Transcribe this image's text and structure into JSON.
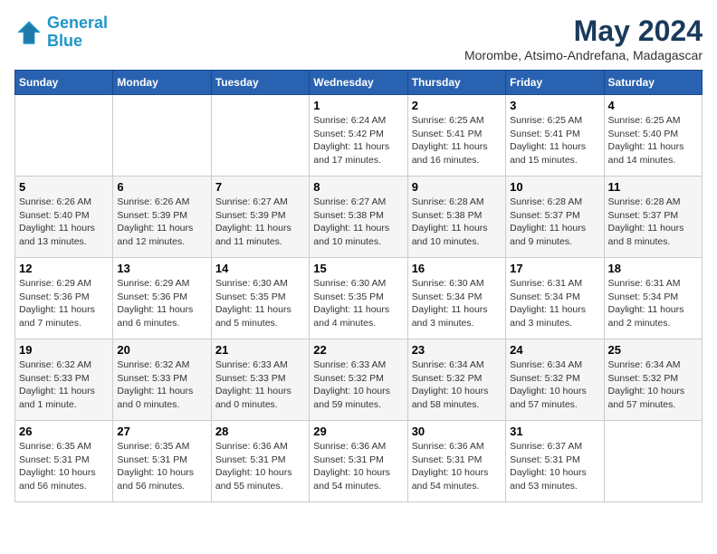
{
  "header": {
    "logo_line1": "General",
    "logo_line2": "Blue",
    "month": "May 2024",
    "location": "Morombe, Atsimo-Andrefana, Madagascar"
  },
  "days_of_week": [
    "Sunday",
    "Monday",
    "Tuesday",
    "Wednesday",
    "Thursday",
    "Friday",
    "Saturday"
  ],
  "weeks": [
    [
      {
        "day": "",
        "info": ""
      },
      {
        "day": "",
        "info": ""
      },
      {
        "day": "",
        "info": ""
      },
      {
        "day": "1",
        "info": "Sunrise: 6:24 AM\nSunset: 5:42 PM\nDaylight: 11 hours and 17 minutes."
      },
      {
        "day": "2",
        "info": "Sunrise: 6:25 AM\nSunset: 5:41 PM\nDaylight: 11 hours and 16 minutes."
      },
      {
        "day": "3",
        "info": "Sunrise: 6:25 AM\nSunset: 5:41 PM\nDaylight: 11 hours and 15 minutes."
      },
      {
        "day": "4",
        "info": "Sunrise: 6:25 AM\nSunset: 5:40 PM\nDaylight: 11 hours and 14 minutes."
      }
    ],
    [
      {
        "day": "5",
        "info": "Sunrise: 6:26 AM\nSunset: 5:40 PM\nDaylight: 11 hours and 13 minutes."
      },
      {
        "day": "6",
        "info": "Sunrise: 6:26 AM\nSunset: 5:39 PM\nDaylight: 11 hours and 12 minutes."
      },
      {
        "day": "7",
        "info": "Sunrise: 6:27 AM\nSunset: 5:39 PM\nDaylight: 11 hours and 11 minutes."
      },
      {
        "day": "8",
        "info": "Sunrise: 6:27 AM\nSunset: 5:38 PM\nDaylight: 11 hours and 10 minutes."
      },
      {
        "day": "9",
        "info": "Sunrise: 6:28 AM\nSunset: 5:38 PM\nDaylight: 11 hours and 10 minutes."
      },
      {
        "day": "10",
        "info": "Sunrise: 6:28 AM\nSunset: 5:37 PM\nDaylight: 11 hours and 9 minutes."
      },
      {
        "day": "11",
        "info": "Sunrise: 6:28 AM\nSunset: 5:37 PM\nDaylight: 11 hours and 8 minutes."
      }
    ],
    [
      {
        "day": "12",
        "info": "Sunrise: 6:29 AM\nSunset: 5:36 PM\nDaylight: 11 hours and 7 minutes."
      },
      {
        "day": "13",
        "info": "Sunrise: 6:29 AM\nSunset: 5:36 PM\nDaylight: 11 hours and 6 minutes."
      },
      {
        "day": "14",
        "info": "Sunrise: 6:30 AM\nSunset: 5:35 PM\nDaylight: 11 hours and 5 minutes."
      },
      {
        "day": "15",
        "info": "Sunrise: 6:30 AM\nSunset: 5:35 PM\nDaylight: 11 hours and 4 minutes."
      },
      {
        "day": "16",
        "info": "Sunrise: 6:30 AM\nSunset: 5:34 PM\nDaylight: 11 hours and 3 minutes."
      },
      {
        "day": "17",
        "info": "Sunrise: 6:31 AM\nSunset: 5:34 PM\nDaylight: 11 hours and 3 minutes."
      },
      {
        "day": "18",
        "info": "Sunrise: 6:31 AM\nSunset: 5:34 PM\nDaylight: 11 hours and 2 minutes."
      }
    ],
    [
      {
        "day": "19",
        "info": "Sunrise: 6:32 AM\nSunset: 5:33 PM\nDaylight: 11 hours and 1 minute."
      },
      {
        "day": "20",
        "info": "Sunrise: 6:32 AM\nSunset: 5:33 PM\nDaylight: 11 hours and 0 minutes."
      },
      {
        "day": "21",
        "info": "Sunrise: 6:33 AM\nSunset: 5:33 PM\nDaylight: 11 hours and 0 minutes."
      },
      {
        "day": "22",
        "info": "Sunrise: 6:33 AM\nSunset: 5:32 PM\nDaylight: 10 hours and 59 minutes."
      },
      {
        "day": "23",
        "info": "Sunrise: 6:34 AM\nSunset: 5:32 PM\nDaylight: 10 hours and 58 minutes."
      },
      {
        "day": "24",
        "info": "Sunrise: 6:34 AM\nSunset: 5:32 PM\nDaylight: 10 hours and 57 minutes."
      },
      {
        "day": "25",
        "info": "Sunrise: 6:34 AM\nSunset: 5:32 PM\nDaylight: 10 hours and 57 minutes."
      }
    ],
    [
      {
        "day": "26",
        "info": "Sunrise: 6:35 AM\nSunset: 5:31 PM\nDaylight: 10 hours and 56 minutes."
      },
      {
        "day": "27",
        "info": "Sunrise: 6:35 AM\nSunset: 5:31 PM\nDaylight: 10 hours and 56 minutes."
      },
      {
        "day": "28",
        "info": "Sunrise: 6:36 AM\nSunset: 5:31 PM\nDaylight: 10 hours and 55 minutes."
      },
      {
        "day": "29",
        "info": "Sunrise: 6:36 AM\nSunset: 5:31 PM\nDaylight: 10 hours and 54 minutes."
      },
      {
        "day": "30",
        "info": "Sunrise: 6:36 AM\nSunset: 5:31 PM\nDaylight: 10 hours and 54 minutes."
      },
      {
        "day": "31",
        "info": "Sunrise: 6:37 AM\nSunset: 5:31 PM\nDaylight: 10 hours and 53 minutes."
      },
      {
        "day": "",
        "info": ""
      }
    ]
  ]
}
